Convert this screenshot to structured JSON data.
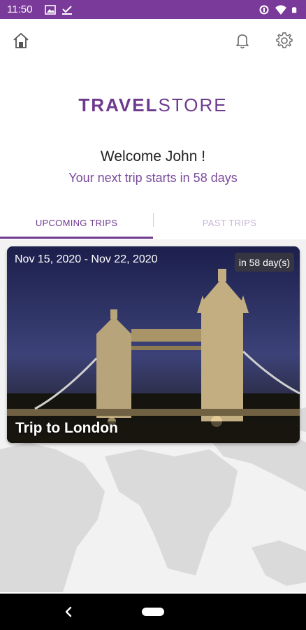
{
  "status_bar": {
    "time": "11:50",
    "icons_left": [
      "image-icon",
      "download-done-icon"
    ],
    "icons_right": [
      "data-saver-icon",
      "wifi-icon",
      "battery-icon"
    ],
    "color": "#7a3a9a"
  },
  "topbar": {
    "icons": [
      "home-icon",
      "bell-icon",
      "gear-icon"
    ]
  },
  "brand": {
    "part1": "TRAVEL",
    "part2": "STORE",
    "color": "#6e3a8e"
  },
  "greeting": {
    "welcome": "Welcome John !",
    "next_trip": "Your next trip starts in 58 days"
  },
  "tabs": [
    {
      "label": "UPCOMING TRIPS",
      "active": true
    },
    {
      "label": "PAST TRIPS",
      "active": false
    }
  ],
  "trips": [
    {
      "dates": "Nov 15, 2020 - Nov 22, 2020",
      "countdown": "in 58 day(s)",
      "title": "Trip to London"
    }
  ],
  "navbar": {
    "icons": [
      "back-icon",
      "home-pill-icon"
    ]
  }
}
